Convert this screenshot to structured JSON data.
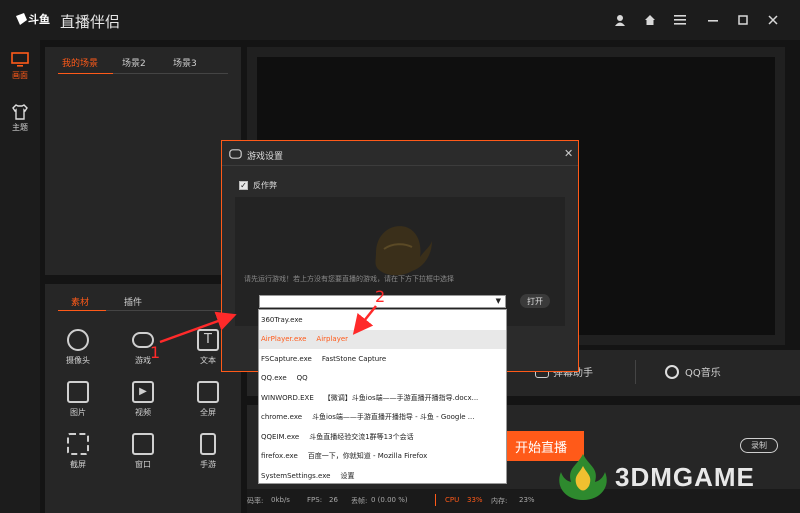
{
  "app": {
    "logo_text": "斗鱼",
    "title": "直播伴侣"
  },
  "rail": [
    {
      "label": "画面",
      "icon": "monitor-icon"
    },
    {
      "label": "主题",
      "icon": "shirt-icon"
    }
  ],
  "scenes": {
    "tabs": [
      "我的场景",
      "场景2",
      "场景3"
    ],
    "active": 0
  },
  "materials": {
    "tabs": [
      "素材",
      "插件"
    ],
    "tools": [
      {
        "label": "摄像头",
        "icon": "camera-icon"
      },
      {
        "label": "游戏",
        "icon": "gamepad-icon"
      },
      {
        "label": "文本",
        "icon": "text-icon"
      },
      {
        "label": "图片",
        "icon": "image-icon"
      },
      {
        "label": "视频",
        "icon": "video-icon"
      },
      {
        "label": "全屏",
        "icon": "fullscreen-icon"
      },
      {
        "label": "截屏",
        "icon": "crop-icon"
      },
      {
        "label": "窗口",
        "icon": "window-icon"
      },
      {
        "label": "手游",
        "icon": "phone-icon"
      }
    ]
  },
  "widgets": {
    "assistant": "弹幕助手",
    "music": "QQ音乐"
  },
  "live": {
    "start_label": "开始直播",
    "record_label": "录制"
  },
  "status": {
    "bitrate_label": "码率:",
    "bitrate_value": "0kb/s",
    "fps_label": "FPS:",
    "fps_value": "26",
    "dropped_label": "丢帧:",
    "dropped_value": "0 (0.00 %)",
    "cpu_label": "CPU",
    "cpu_value": "33%",
    "mem_label": "内存:",
    "mem_value": "23%"
  },
  "dialog": {
    "title": "游戏设置",
    "anti_cheat_label": "反作弊",
    "anti_cheat_checked": true,
    "hint": "请先运行游戏！若上方没有您要直播的游戏，请在下方下拉框中选择",
    "select_value": "",
    "open_label": "打开"
  },
  "dropdown": {
    "selected_index": 1,
    "options": [
      {
        "exe": "360Tray.exe",
        "title": ""
      },
      {
        "exe": "AirPlayer.exe",
        "title": "Airplayer"
      },
      {
        "exe": "FSCapture.exe",
        "title": "FastStone Capture"
      },
      {
        "exe": "QQ.exe",
        "title": "QQ"
      },
      {
        "exe": "WINWORD.EXE",
        "title": "【微调】斗鱼ios端——手游直播开播指导.docx..."
      },
      {
        "exe": "chrome.exe",
        "title": "斗鱼ios端——手游直播开播指导 - 斗鱼 - Google ..."
      },
      {
        "exe": "QQEIM.exe",
        "title": "斗鱼直播经验交流1群等13个会话"
      },
      {
        "exe": "firefox.exe",
        "title": "百度一下，你就知道 - Mozilla Firefox"
      },
      {
        "exe": "SystemSettings.exe",
        "title": "设置"
      }
    ]
  },
  "annotations": {
    "step1": "1",
    "step2": "2"
  },
  "watermark": "3DMGAME",
  "colors": {
    "accent": "#ff5a19",
    "annotation": "#ff2a2a",
    "bg": "#141414",
    "panel": "#262626"
  }
}
